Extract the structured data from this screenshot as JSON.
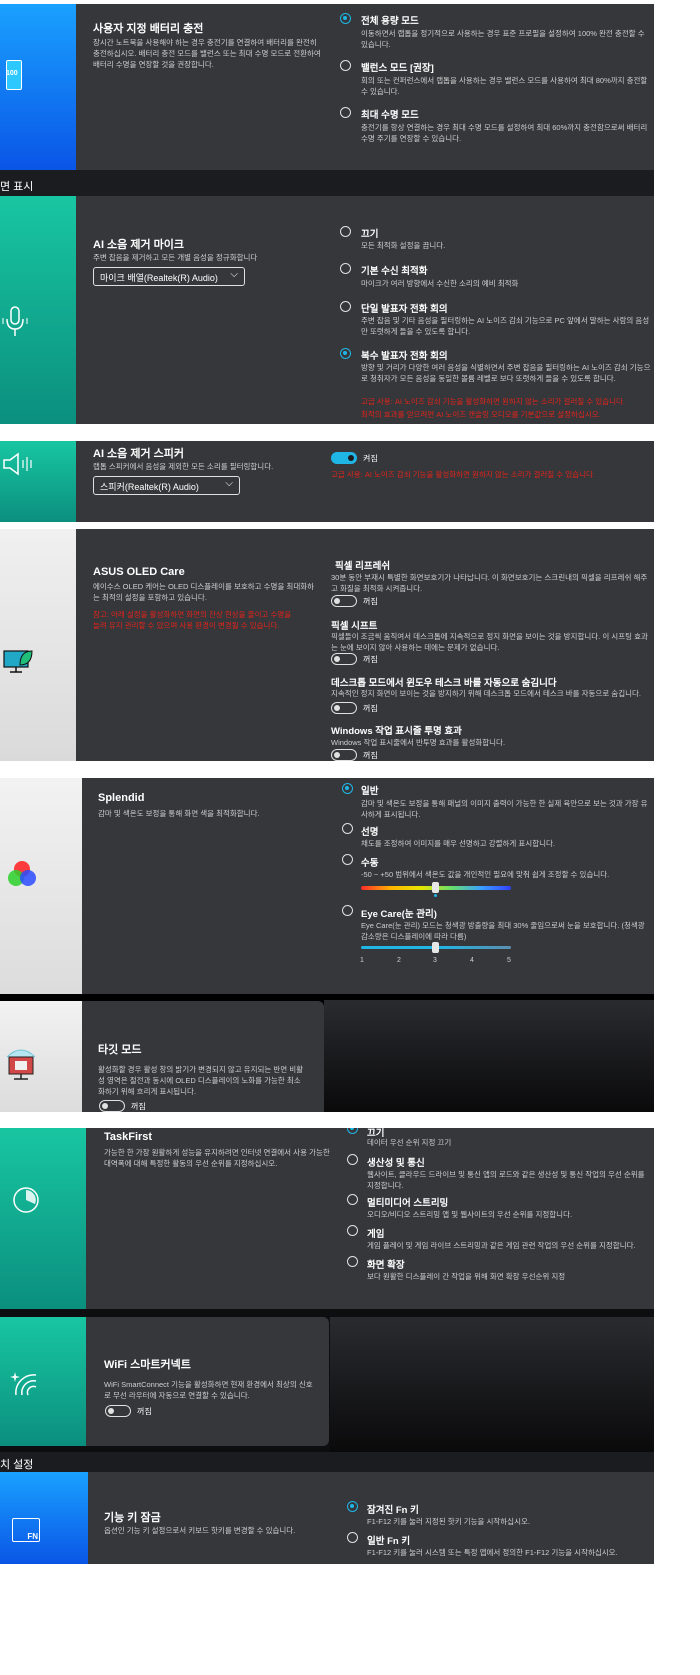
{
  "sec1": {
    "icon_text": "100",
    "title": "사용자 지정 배터리 충전",
    "desc": "장시간 노트북을 사용해야 하는 경우 충전기를 연결하여 배터리를 완전히 충전하십시오. 배터리 충전 모드를 밸런스 또는 최대 수명 모드로 전환하여 배터리 수명을 연장할 것을 권장합니다.",
    "options": [
      {
        "title": "전체 용량 모드",
        "desc": "이동하면서 랩톱을 정기적으로 사용하는 경우 표준 프로필을 설정하여 100% 완전 충전할 수 있습니다.",
        "selected": true
      },
      {
        "title": "밸런스 모드 [권장]",
        "desc": "회의 또는 컨퍼런스에서 랩톱을 사용하는 경우 밸런스 모드를 사용하여 최대 80%까지 충전할 수 있습니다.",
        "selected": false
      },
      {
        "title": "최대 수명 모드",
        "desc": "충전기를 항상 연결하는 경우 최대 수명 모드를 설정하여 최대 60%까지 충전함으로써 배터리 수명 주기를 연장할 수 있습니다.",
        "selected": false
      }
    ]
  },
  "band1": "면 표시",
  "sec2": {
    "title": "AI 소음 제거 마이크",
    "desc": "주변 잡음을 제거하고 모든 개별 음성을 정규화합니다",
    "dropdown": "마이크 배열(Realtek(R) Audio)",
    "options": [
      {
        "title": "끄기",
        "desc": "모든 최적화 설정을 끕니다.",
        "selected": false
      },
      {
        "title": "기본 수신 최적화",
        "desc": "마이크가 여러 방향에서 수신한 소리의 예비 최적화",
        "selected": false
      },
      {
        "title": "단일 발표자 전화 회의",
        "desc": "주변 잡음 및 기타 음성을 필터링하는 AI 노이즈 감쇠 기능으로 PC 앞에서 말하는 사람의 음성만 또렷하게 들을 수 있도록 합니다.",
        "selected": false
      },
      {
        "title": "복수 발표자 전화 회의",
        "desc": "방향 및 거리가 다양한 여러 음성을 식별하면서 주변 잡음을 필터링하는 AI 노이즈 감쇠 기능으로 청취자가 모든 음성을 동일한 볼륨 레벨로 보다 또렷하게 들을 수 있도록 합니다.",
        "selected": true
      }
    ],
    "warn1": "고급 사용: AI 노이즈 감쇠 기능을 활성화하면 원하지 않는 소리가 걸러질 수 있습니다.",
    "warn2": "최적의 효과를 얻으려면 AI 노이즈 캔슬링 오디오를 기본값으로 설정하십시오."
  },
  "sec3": {
    "title": "AI 소음 제거 스피커",
    "desc": "랩톱 스피커에서 음성을 제외한 모든 소리를 필터링합니다.",
    "dropdown": "스피커(Realtek(R) Audio)",
    "toggle_label": "켜짐",
    "warn": "고급 사용: AI 노이즈 감쇠 기능을 활성화하면 원하지 않는 소리가 걸러질 수 있습니다."
  },
  "sec4": {
    "title": "ASUS OLED Care",
    "desc": "에이수스 OLED 케어는 OLED 디스플레이를 보호하고 수명을 최대화하는 최적의 설정을 포함하고 있습니다.",
    "warn": "참고: 아래 설정을 활성화하면 화면의 잔상 현상을 줄이고 수명을 늘려 유지 관리할 수 있으며 사용 환경이 변경될 수 있습니다.",
    "items": [
      {
        "title": "픽셀 리프레쉬",
        "desc": "30분 동안 부재시 특별한 화면보호기가 나타납니다. 이 화면보호기는 스크린내의 픽셀을 리프레쉬 해주고 화질을 최적화 시켜줍니다.",
        "state": "꺼짐"
      },
      {
        "title": "픽셀 시프트",
        "desc": "픽셀들이 조금씩 움직여서 데스크톱에 지속적으로 정지 화면을 보이는 것을 방지합니다. 이 시프팅 효과는 눈에 보이지 않아 사용하는 데에는 문제가 없습니다.",
        "state": "꺼짐"
      },
      {
        "title": "데스크톱 모드에서 윈도우 테스크 바를 자동으로 숨김니다",
        "desc": "지속적인 정지 화면이 보이는 것을 방지하기 위해 데스크톱 모드에서 테스크 바를 자동으로 숨깁니다.",
        "state": "꺼짐"
      },
      {
        "title": "Windows 작업 표시줄 투명 효과",
        "desc": "Windows 작업 표시줄에서 반투명 효과를 활성화합니다.",
        "state": "꺼짐"
      }
    ]
  },
  "sec5": {
    "title": "Splendid",
    "desc": "감마 및 색온도 보정을 통해 화면 색을 최적화합니다.",
    "options": [
      {
        "title": "일반",
        "desc": "감마 및 색온도 보정을 통해 패널의 이미지 출력이 가능한 한 실제 육안으로 보는 것과 가장 유사하게 표시됩니다.",
        "selected": true
      },
      {
        "title": "선명",
        "desc": "채도를 조정하여 이미지를 매우 선명하고 강렬하게 표시합니다.",
        "selected": false
      },
      {
        "title": "수동",
        "desc": "-50 ~ +50 범위에서 색온도 값을 개인적인 필요에 맞춰 쉽게 조정할 수 있습니다.",
        "selected": false
      },
      {
        "title": "Eye Care(눈 관리)",
        "desc": "Eye Care(눈 관리) 모드는 청색광 방출량을 최대 30% 줄임으로써 눈을 보호합니다. (청색광 감소량은 디스플레이에 따라 다름)",
        "selected": false
      }
    ],
    "manual_slider_value": 0,
    "eyecare_ticks": [
      "1",
      "2",
      "3",
      "4",
      "5"
    ],
    "eyecare_value": 3
  },
  "sec6": {
    "title": "타깃 모드",
    "desc": "활성화할 경우 활성 창의 밝기가 변경되지 않고 유지되는 반면 비활성 영역은 절전과 동시에 OLED 디스플레이의 노화를 가능한 최소화하기 위해 흐리게 표시됩니다.",
    "state": "꺼짐"
  },
  "sec7": {
    "title": "TaskFirst",
    "desc": "가능한 한 가장 원활하게 성능을 유지하려면 인터넷 연결에서 사용 가능한 대역폭에 대해 특정한 활동의 우선 순위를 지정하십시오.",
    "options": [
      {
        "title": "끄기",
        "desc": "데이터 우선 순위 지정 끄기",
        "selected": true
      },
      {
        "title": "생산성 및 통신",
        "desc": "웹사이트, 클라우드 드라이브 및 통신 앱의 로드와 같은 생산성 및 통신 작업의 우선 순위를 지정합니다.",
        "selected": false
      },
      {
        "title": "멀티미디어 스트리밍",
        "desc": "오디오/비디오 스트리밍 앱 및 웹사이트의 우선 순위를 지정합니다.",
        "selected": false
      },
      {
        "title": "게임",
        "desc": "게임 플레이 및 게임 라이브 스트리밍과 같은 게임 관련 작업의 우선 순위를 지정합니다.",
        "selected": false
      },
      {
        "title": "화면 확장",
        "desc": "보다 원활한 디스플레이 간 작업을 위해 화면 확장 우선순위 지정",
        "selected": false
      }
    ]
  },
  "sec8": {
    "title": "WiFi 스마트커넥트",
    "desc": "WiFi SmartConnect 기능을 활성화하면 현재 환경에서 최상의 신호로 무선 라우터에 자동으로 연결할 수 있습니다.",
    "state": "꺼짐"
  },
  "band2": "치 설정",
  "sec9": {
    "icon_text": "FN",
    "title": "기능 키 잠금",
    "desc": "옵션인 기능 키 설정으로서 키보드 핫키를 변경할 수 있습니다.",
    "options": [
      {
        "title": "잠겨진 Fn 키",
        "desc": "F1-F12 키를 눌러 지정된 핫키 기능을 시작하십시오.",
        "selected": true
      },
      {
        "title": "일반 Fn 키",
        "desc": "F1-F12 키를 눌러 시스템 또는 특정 앱에서 정의한 F1-F12 기능을 시작하십시오.",
        "selected": false
      }
    ]
  },
  "colors": {
    "accent": "#1fb6e6",
    "panel": "#36373b",
    "warning": "#e2231a",
    "battery_blue": "#1264f0",
    "teal": "#0fb39a"
  }
}
